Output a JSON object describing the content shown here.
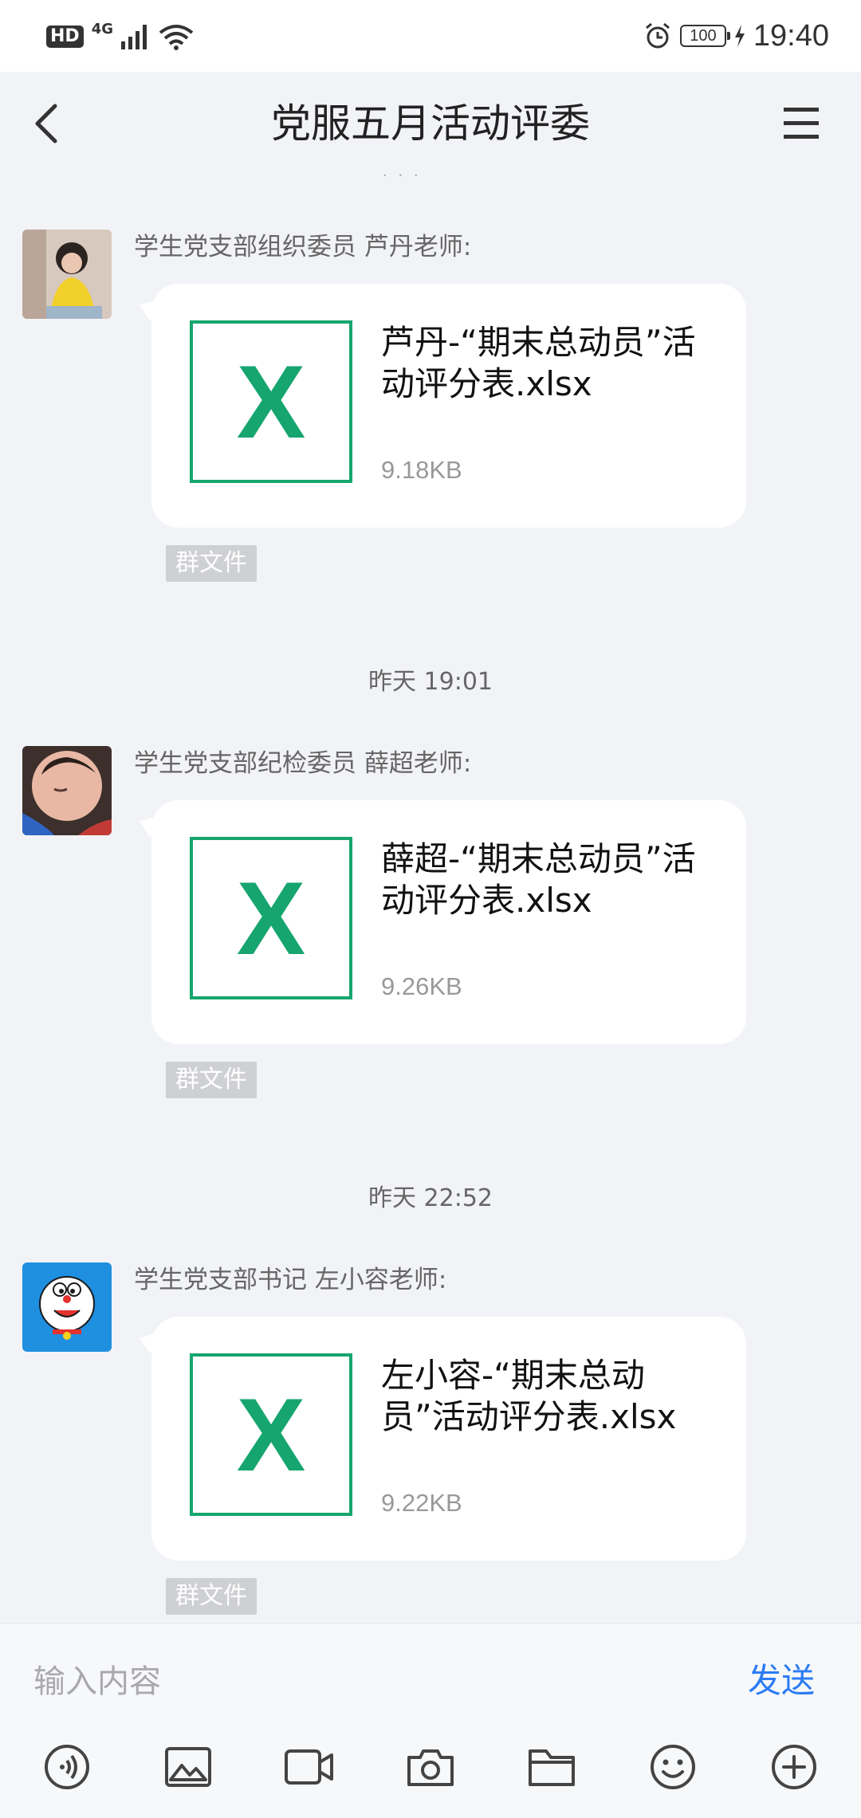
{
  "status_bar": {
    "hd": "HD",
    "network": "4G",
    "battery": "100",
    "time": "19:40"
  },
  "header": {
    "title": "党服五月活动评委"
  },
  "messages": [
    {
      "sender": "学生党支部组织委员 芦丹老师:",
      "file_icon": "X",
      "file_name": "芦丹-“期末总动员”活动评分表.xlsx",
      "file_size": "9.18KB",
      "tag": "群文件"
    },
    {
      "sender": "学生党支部纪检委员 薛超老师:",
      "file_icon": "X",
      "file_name": "薛超-“期末总动员”活动评分表.xlsx",
      "file_size": "9.26KB",
      "tag": "群文件"
    },
    {
      "sender": "学生党支部书记 左小容老师:",
      "file_icon": "X",
      "file_name": "左小容-“期末总动员”活动评分表.xlsx",
      "file_size": "9.22KB",
      "tag": "群文件"
    }
  ],
  "timestamps": [
    "昨天 19:01",
    "昨天 22:52"
  ],
  "input": {
    "placeholder": "输入内容",
    "send_label": "发送"
  },
  "colors": {
    "accent": "#2c7cf4",
    "excel_green": "#16a56f",
    "background": "#f2f3f6"
  },
  "toolbar_icons": [
    "voice-icon",
    "image-icon",
    "video-icon",
    "camera-icon",
    "folder-icon",
    "emoji-icon",
    "plus-icon"
  ]
}
